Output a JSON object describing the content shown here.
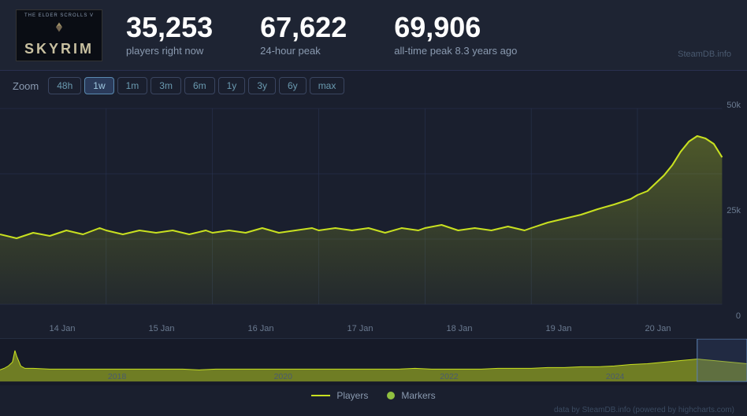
{
  "header": {
    "game": {
      "series": "The Elder Scrolls V",
      "title": "SKYRIM"
    },
    "stats": {
      "players_now": "35,253",
      "players_now_label": "players right now",
      "peak_24h": "67,622",
      "peak_24h_label": "24-hour peak",
      "peak_alltime": "69,906",
      "peak_alltime_label": "all-time peak 8.3 years ago"
    },
    "credit": "SteamDB.info"
  },
  "zoom": {
    "label": "Zoom",
    "options": [
      "48h",
      "1w",
      "1m",
      "3m",
      "6m",
      "1y",
      "3y",
      "6y",
      "max"
    ],
    "active": "1w"
  },
  "chart": {
    "y_labels": [
      "50k",
      "25k",
      "0"
    ],
    "x_labels": [
      "14 Jan",
      "15 Jan",
      "16 Jan",
      "17 Jan",
      "18 Jan",
      "19 Jan",
      "20 Jan"
    ]
  },
  "mini_chart": {
    "year_labels": [
      "2018",
      "2020",
      "2022",
      "2024"
    ]
  },
  "legend": {
    "players_label": "Players",
    "markers_label": "Markers"
  },
  "footer_credit": "data by SteamDB.info (powered by highcharts.com)"
}
